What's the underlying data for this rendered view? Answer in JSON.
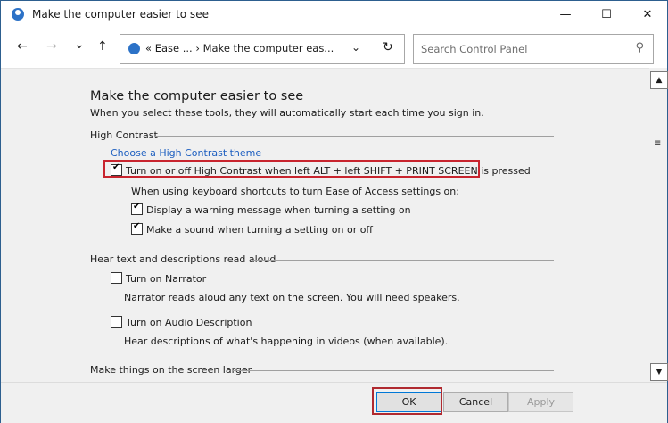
{
  "window": {
    "title": "Make the computer easier to see"
  },
  "titlebar": {
    "minimize": "—",
    "maximize": "☐",
    "close": "✕"
  },
  "nav": {
    "back": "←",
    "forward": "→",
    "recent": "⌄",
    "up": "↑",
    "address_crumbs": "«  Ease ...  ›  Make the computer eas...",
    "address_dropdown": "⌄",
    "refresh": "↻",
    "search_placeholder": "Search Control Panel",
    "search_icon": "⚲"
  },
  "main": {
    "heading": "Make the computer easier to see",
    "subheading": "When you select these tools, they will automatically start each time you sign in.",
    "high_contrast": {
      "section_title": "High Contrast",
      "choose_theme_link": "Choose a High Contrast theme",
      "toggle_shortcut": {
        "label": "Turn on or off High Contrast when left ALT + left SHIFT + PRINT SCREEN is pressed",
        "checked": true
      },
      "shortcut_note": "When using keyboard shortcuts to turn Ease of Access settings on:",
      "warning_message": {
        "label": "Display a warning message when turning a setting on",
        "checked": true
      },
      "make_sound": {
        "label": "Make a sound when turning a setting on or off",
        "checked": true
      }
    },
    "read_aloud": {
      "section_title": "Hear text and descriptions read aloud",
      "narrator": {
        "label": "Turn on Narrator",
        "checked": false,
        "desc": "Narrator reads aloud any text on the screen. You will need speakers."
      },
      "audio_description": {
        "label": "Turn on Audio Description",
        "checked": false,
        "desc": "Hear descriptions of what's happening in videos (when available)."
      }
    },
    "larger": {
      "section_title": "Make things on the screen larger"
    }
  },
  "footer": {
    "ok": "OK",
    "cancel": "Cancel",
    "apply": "Apply"
  },
  "colors": {
    "highlight": "#c8242e",
    "link": "#1c5ec0",
    "accent": "#0078d7"
  }
}
